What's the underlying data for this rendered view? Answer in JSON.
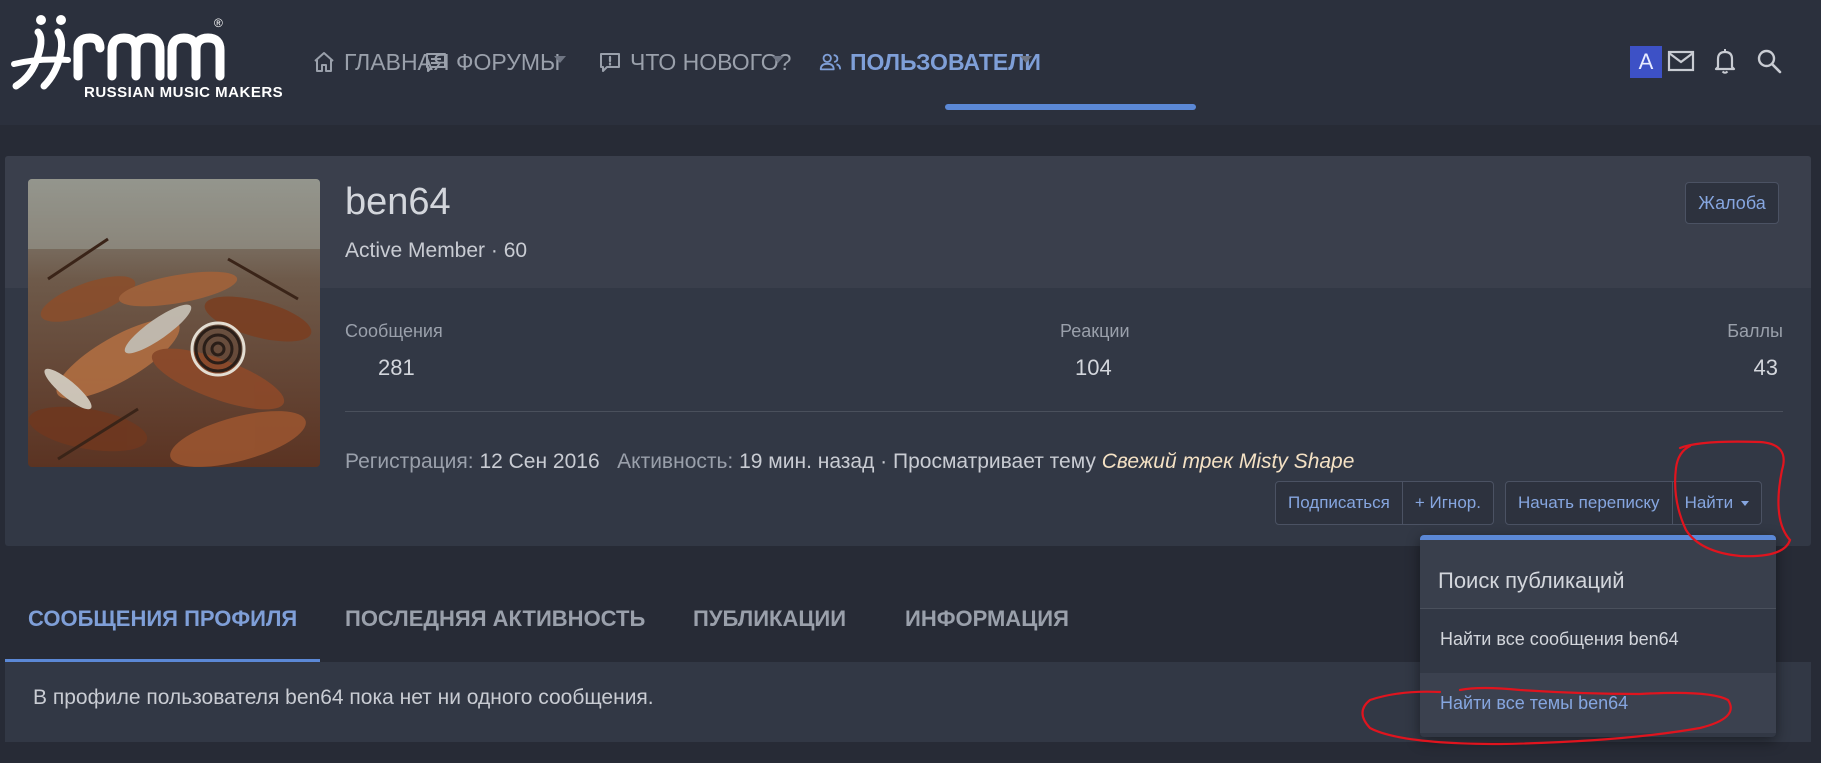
{
  "brand": {
    "logo_letters": "rmm",
    "logo_text": "RUSSIAN MUSIC MAKERS",
    "registered": "®"
  },
  "nav": {
    "items": [
      {
        "label": "ГЛАВНАЯ",
        "icon": "home-icon"
      },
      {
        "label": "ФОРУМЫ",
        "icon": "forum-icon"
      },
      {
        "label": "ЧТО НОВОГО?",
        "icon": "whats-new-icon"
      },
      {
        "label": "ПОЛЬЗОВАТЕЛИ",
        "icon": "users-icon",
        "active": true
      }
    ]
  },
  "header_right": {
    "avatar_letter": "A",
    "icons": [
      "mail-icon",
      "bell-icon",
      "search-icon"
    ]
  },
  "profile": {
    "username": "ben64",
    "user_title": "Active Member · 60",
    "report_button": "Жалоба",
    "stats": {
      "messages_label": "Сообщения",
      "messages_value": "281",
      "reactions_label": "Реакции",
      "reactions_value": "104",
      "points_label": "Баллы",
      "points_value": "43"
    },
    "registration_label": "Регистрация:",
    "registration_date": "12 Сен 2016",
    "activity_label": "Активность:",
    "activity_value": "19 мин. назад · Просматривает тему",
    "activity_thread": "Свежий трек Misty Shape"
  },
  "actions": {
    "follow": "Подписаться",
    "ignore": "+ Игнор.",
    "start_conversation": "Начать переписку",
    "find": "Найти"
  },
  "tabs": [
    {
      "label": "СООБЩЕНИЯ ПРОФИЛЯ",
      "active": true
    },
    {
      "label": "ПОСЛЕДНЯЯ АКТИВНОСТЬ"
    },
    {
      "label": "ПУБЛИКАЦИИ"
    },
    {
      "label": "ИНФОРМАЦИЯ"
    }
  ],
  "tab_content": {
    "empty_message": "В профиле пользователя ben64 пока нет ни одного сообщения."
  },
  "find_menu": {
    "header": "Поиск публикаций",
    "items": [
      {
        "label": "Найти все сообщения ben64"
      },
      {
        "label": "Найти все темы ben64",
        "highlighted": true
      }
    ]
  },
  "colors": {
    "accent": "#5b88d6",
    "link": "#86a6e0",
    "annotation": "#e0141e",
    "thread_link": "#f4e1c4"
  }
}
